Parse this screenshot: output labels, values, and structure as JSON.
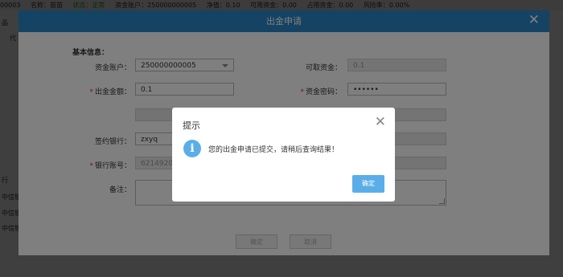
{
  "status_bar": {
    "id": "00003",
    "name": "名称：苗苗",
    "state": "状态：正常",
    "account": "资金账户：250000000005",
    "net": "净值：0.10",
    "available": "可用资金：0.00",
    "occupied": "占用资金：0.00",
    "risk": "风险率：0.00%"
  },
  "background": {
    "left_labels": [
      "品",
      "代",
      "行",
      "中信银",
      "中信银",
      "中信银"
    ]
  },
  "withdraw_dialog": {
    "title": "出金申请",
    "section_title": "基本信息：",
    "account_label": "资金账户：",
    "account_value": "250000000005",
    "withdrawable_label": "可取资金：",
    "withdrawable_value": "0.1",
    "amount_label": "出金金额：",
    "amount_value": "0.1",
    "password_label": "资金密码：",
    "password_value": "••••••",
    "query_button": "查询",
    "bank_label": "签约银行：",
    "bank_value": "zxyq",
    "bank_account_label": "银行账号：",
    "bank_account_value": "621492021",
    "bank_account_suffix": "5",
    "note_label": "备注：",
    "confirm_button": "确定",
    "cancel_button": "取消"
  },
  "alert": {
    "title": "提示",
    "message": "您的出金申请已提交，请稍后查询结果！",
    "ok_button": "确定"
  },
  "colors": {
    "header_blue": "#2a86c8",
    "info_blue": "#5aaee8"
  }
}
